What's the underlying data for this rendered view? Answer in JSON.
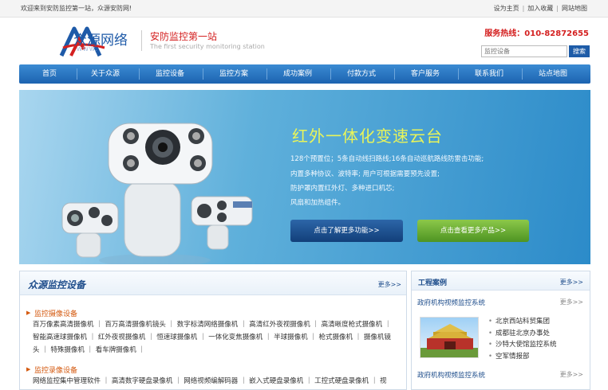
{
  "topbar": {
    "welcome": "欢迎来到安防监控第一站，众源安防网!",
    "links": [
      "设为主页",
      "加入收藏",
      "网站地图"
    ]
  },
  "header": {
    "logo_text": "众源网络",
    "logo_sub": "WWW.",
    "site_title": "安防监控第一站",
    "site_en": "The first security monitoring station",
    "hotline": "服务热线：010-82872655"
  },
  "search": {
    "placeholder": "监控设备",
    "button": "搜索"
  },
  "nav": [
    "首页",
    "关于众源",
    "监控设备",
    "监控方案",
    "成功案例",
    "付款方式",
    "客户服务",
    "联系我们",
    "站点地图"
  ],
  "banner": {
    "title": "红外一体化变速云台",
    "lines": [
      "128个预置位；5条自动线扫路线;16条自动巡航路线防雷击功能;",
      "内置多种协议、波特率; 用户可根据需要预先设置;",
      "防护罩内置红外灯、多种进口机芯;",
      "风扇和加热组件。"
    ],
    "btn_more_func": "点击了解更多功能>>",
    "btn_more_product": "点击查看更多产品>>"
  },
  "equipment": {
    "title": "众源监控设备",
    "more": "更多>>",
    "cat1": {
      "title": "监控摄像设备",
      "line1": "百万像素高清摄像机 ｜ 百万高清摄像机镜头 ｜ 数字标清网络摄像机 ｜ 高清红外夜视摄像机 ｜ 高清晰度枪式摄像机 ｜",
      "line2": "智能高速球摄像机 ｜ 红外夜视摄像机 ｜ 恒速球摄像机 ｜ 一体化变焦摄像机 ｜ 半球摄像机 ｜ 枪式摄像机 ｜ 摄像机镜",
      "line3": "头 ｜ 特殊摄像机 ｜ 看车牌摄像机 ｜"
    },
    "cat2": {
      "title": "监控录像设备",
      "line1": "网络监控集中管理软件 ｜ 高清数字硬盘录像机 ｜ 网络视频编解码器 ｜ 嵌入式硬盘录像机 ｜ 工控式硬盘录像机 ｜ 视"
    }
  },
  "cases": {
    "title": "工程案例",
    "more": "更多>>",
    "sub1_title": "政府机构视频监控系统",
    "sub1_more": "更多>>",
    "items": [
      "北京西站科贸集团",
      "成都驻北京办事处",
      "沙特大使馆监控系统",
      "空军情报部"
    ],
    "sub2_title": "政府机构视频监控系统",
    "sub2_more": "更多>>"
  }
}
